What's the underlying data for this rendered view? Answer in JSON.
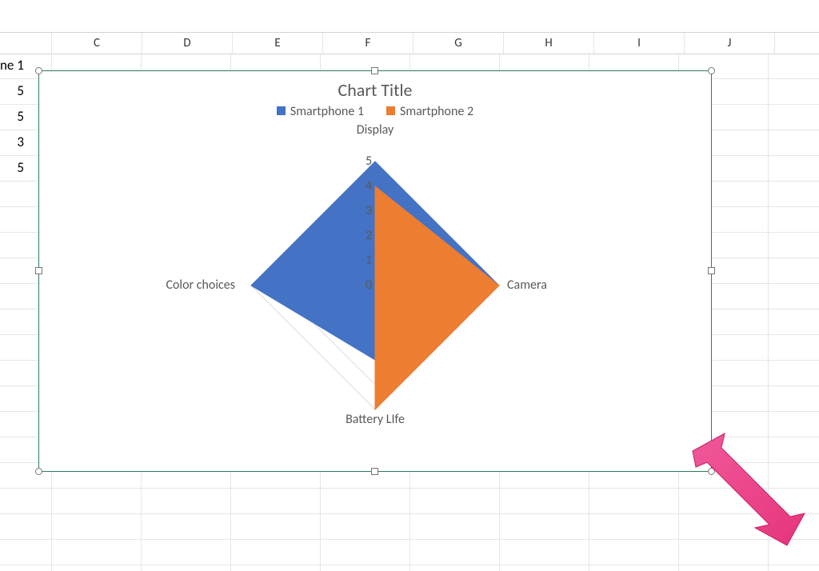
{
  "spreadsheet": {
    "column_headers": [
      "C",
      "D",
      "E",
      "F",
      "G",
      "H",
      "I",
      "J"
    ],
    "left_edge_cells": {
      "row1_partial_label": "ne 1",
      "values": [
        "5",
        "5",
        "3",
        "5"
      ]
    }
  },
  "chart": {
    "title": "Chart Title",
    "legend": {
      "series1": "Smartphone 1",
      "series2": "Smartphone 2"
    },
    "axes": {
      "top": "Display",
      "right": "Camera",
      "bottom": "Battery LIfe",
      "left": "Color choices"
    },
    "ticks": {
      "t0": "0",
      "t1": "1",
      "t2": "2",
      "t3": "3",
      "t4": "4",
      "t5": "5"
    }
  },
  "chart_data": {
    "type": "radar",
    "categories": [
      "Display",
      "Camera",
      "Battery LIfe",
      "Color choices"
    ],
    "series": [
      {
        "name": "Smartphone 1",
        "values": [
          5,
          5,
          3,
          5
        ],
        "color": "#4472c4"
      },
      {
        "name": "Smartphone 2",
        "values": [
          4,
          5,
          5,
          0
        ],
        "color": "#ed7d31"
      }
    ],
    "radial": {
      "min": 0,
      "max": 5,
      "ticks": [
        0,
        1,
        2,
        3,
        4,
        5
      ]
    },
    "title": "Chart Title",
    "legend_position": "top"
  },
  "colors": {
    "series1": "#4472c4",
    "series2": "#ed7d31",
    "selection_border": "#2f7d5b",
    "arrow": "#e6347b"
  }
}
